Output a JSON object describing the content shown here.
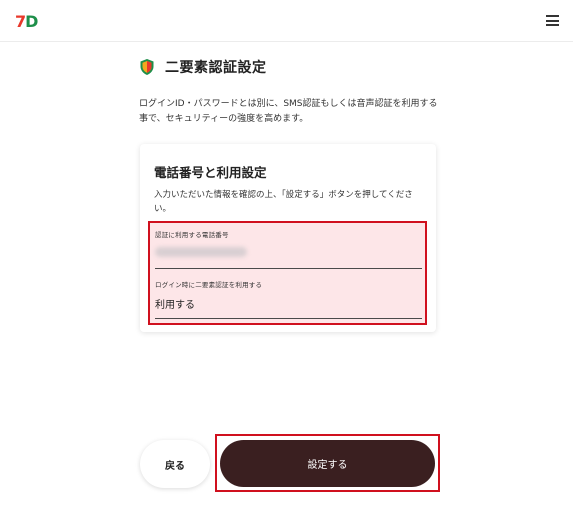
{
  "header": {
    "logo_seven": "7",
    "logo_d": "D",
    "menu_icon": "hamburger-menu-icon"
  },
  "page": {
    "title": "二要素認証設定",
    "title_icon": "shield-icon",
    "description": "ログインID・パスワードとは別に、SMS認証もしくは音声認証を利用する事で、セキュリティーの強度を高めます。"
  },
  "card": {
    "title": "電話番号と利用設定",
    "description": "入力いただいた情報を確認の上、「設定する」ボタンを押してください。",
    "phone_field": {
      "label": "認証に利用する電話番号"
    },
    "twofactor_field": {
      "label": "ログイン時に二要素認証を利用する",
      "value": "利用する"
    }
  },
  "actions": {
    "back_label": "戻る",
    "submit_label": "設定する"
  },
  "colors": {
    "highlight_border": "#d0101e",
    "highlight_fill": "#fde6e8",
    "submit_bg": "#3a1f20",
    "logo_red": "#e8382b",
    "logo_green": "#1e8f4a"
  }
}
